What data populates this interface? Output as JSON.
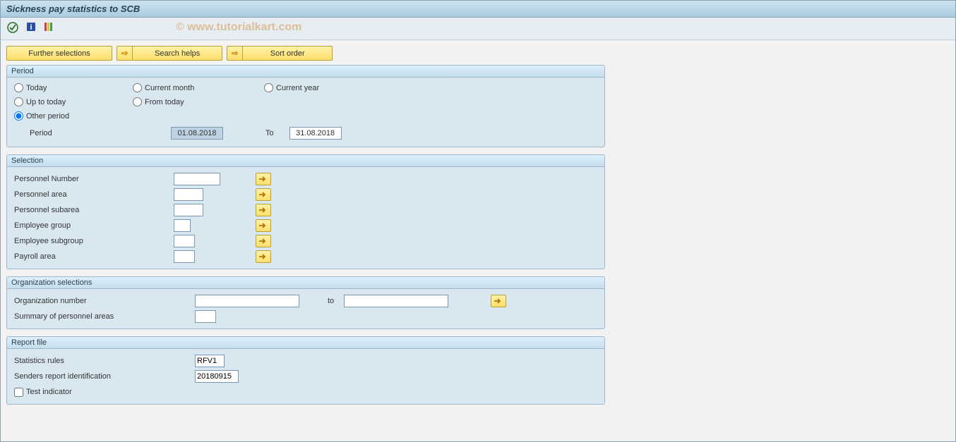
{
  "title": "Sickness pay statistics to SCB",
  "watermark": "© www.tutorialkart.com",
  "button_bar": {
    "further_selections": "Further selections",
    "search_helps": "Search helps",
    "sort_order": "Sort order"
  },
  "period_group": {
    "title": "Period",
    "today": "Today",
    "current_month": "Current month",
    "current_year": "Current year",
    "up_to_today": "Up to today",
    "from_today": "From today",
    "other_period": "Other period",
    "period_label": "Period",
    "period_from": "01.08.2018",
    "to_label": "To",
    "period_to": "31.08.2018"
  },
  "selection_group": {
    "title": "Selection",
    "personnel_number": "Personnel Number",
    "personnel_area": "Personnel area",
    "personnel_subarea": "Personnel subarea",
    "employee_group": "Employee group",
    "employee_subgroup": "Employee subgroup",
    "payroll_area": "Payroll area"
  },
  "org_group": {
    "title": "Organization selections",
    "org_number": "Organization number",
    "to": "to",
    "summary": "Summary of personnel areas"
  },
  "report_group": {
    "title": "Report file",
    "stat_rules": "Statistics rules",
    "stat_rules_val": "RFV1",
    "sender": "Senders report identification",
    "sender_val": "20180915",
    "test_indicator": "Test indicator"
  }
}
